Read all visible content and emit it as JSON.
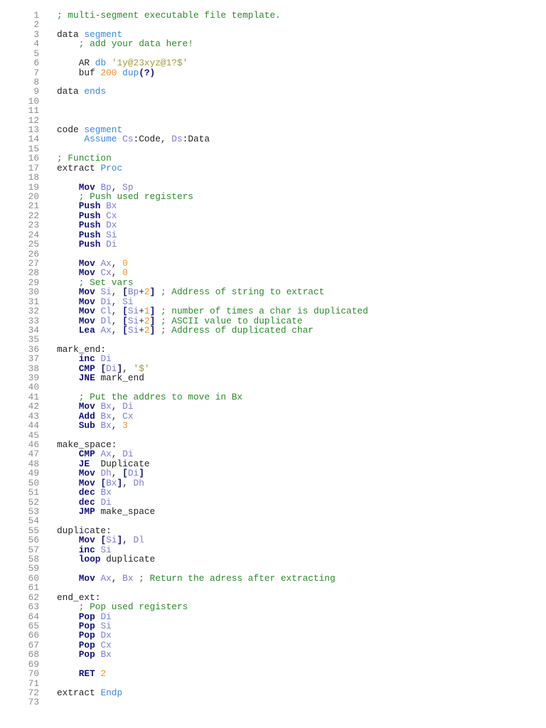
{
  "code": {
    "lines": [
      {
        "t": [
          [
            "; multi-segment executable file template.",
            "c"
          ]
        ]
      },
      {
        "t": []
      },
      {
        "t": [
          [
            "data ",
            "p"
          ],
          [
            "segment",
            "d"
          ]
        ]
      },
      {
        "t": [
          [
            "    ; add your data here!",
            "c"
          ]
        ]
      },
      {
        "t": []
      },
      {
        "t": [
          [
            "    AR ",
            "p"
          ],
          [
            "db ",
            "d"
          ],
          [
            "'1y@23xyz@1?$'",
            "s"
          ]
        ]
      },
      {
        "t": [
          [
            "    buf ",
            "p"
          ],
          [
            "200 ",
            "n"
          ],
          [
            "dup",
            "d"
          ],
          [
            "(?)",
            "o"
          ]
        ]
      },
      {
        "t": []
      },
      {
        "t": [
          [
            "data ",
            "p"
          ],
          [
            "ends",
            "d"
          ]
        ]
      },
      {
        "t": []
      },
      {
        "t": []
      },
      {
        "t": []
      },
      {
        "t": [
          [
            "code ",
            "p"
          ],
          [
            "segment",
            "d"
          ]
        ]
      },
      {
        "t": [
          [
            "     Assume ",
            "d"
          ],
          [
            "Cs",
            "r"
          ],
          [
            ":Code, ",
            "p"
          ],
          [
            "Ds",
            "r"
          ],
          [
            ":Data",
            "p"
          ]
        ]
      },
      {
        "t": []
      },
      {
        "t": [
          [
            "; Function",
            "c"
          ]
        ]
      },
      {
        "t": [
          [
            "extract ",
            "p"
          ],
          [
            "Proc",
            "d"
          ]
        ]
      },
      {
        "t": []
      },
      {
        "t": [
          [
            "    Mov ",
            "k"
          ],
          [
            "Bp",
            "r"
          ],
          [
            ", ",
            "p"
          ],
          [
            "Sp",
            "r"
          ]
        ]
      },
      {
        "t": [
          [
            "    ; Push used registers",
            "c"
          ]
        ]
      },
      {
        "t": [
          [
            "    Push ",
            "k"
          ],
          [
            "Bx",
            "r"
          ]
        ]
      },
      {
        "t": [
          [
            "    Push ",
            "k"
          ],
          [
            "Cx",
            "r"
          ]
        ]
      },
      {
        "t": [
          [
            "    Push ",
            "k"
          ],
          [
            "Dx",
            "r"
          ]
        ]
      },
      {
        "t": [
          [
            "    Push ",
            "k"
          ],
          [
            "Si",
            "r"
          ]
        ]
      },
      {
        "t": [
          [
            "    Push ",
            "k"
          ],
          [
            "Di",
            "r"
          ]
        ]
      },
      {
        "t": []
      },
      {
        "t": [
          [
            "    Mov ",
            "k"
          ],
          [
            "Ax",
            "r"
          ],
          [
            ", ",
            "p"
          ],
          [
            "0",
            "n"
          ]
        ]
      },
      {
        "t": [
          [
            "    Mov ",
            "k"
          ],
          [
            "Cx",
            "r"
          ],
          [
            ", ",
            "p"
          ],
          [
            "0",
            "n"
          ]
        ]
      },
      {
        "t": [
          [
            "    ; Set vars",
            "c"
          ]
        ]
      },
      {
        "t": [
          [
            "    Mov ",
            "k"
          ],
          [
            "Si",
            "r"
          ],
          [
            ", ",
            "p"
          ],
          [
            "[",
            "o"
          ],
          [
            "Bp",
            "r"
          ],
          [
            "+",
            "p"
          ],
          [
            "2",
            "n"
          ],
          [
            "]",
            "o"
          ],
          [
            " ; Address of string to extract",
            "c"
          ]
        ]
      },
      {
        "t": [
          [
            "    Mov ",
            "k"
          ],
          [
            "Di",
            "r"
          ],
          [
            ", ",
            "p"
          ],
          [
            "Si",
            "r"
          ]
        ]
      },
      {
        "t": [
          [
            "    Mov ",
            "k"
          ],
          [
            "Cl",
            "r"
          ],
          [
            ", ",
            "p"
          ],
          [
            "[",
            "o"
          ],
          [
            "Si",
            "r"
          ],
          [
            "+",
            "p"
          ],
          [
            "1",
            "n"
          ],
          [
            "]",
            "o"
          ],
          [
            " ; number of times a char is duplicated",
            "c"
          ]
        ]
      },
      {
        "t": [
          [
            "    Mov ",
            "k"
          ],
          [
            "Dl",
            "r"
          ],
          [
            ", ",
            "p"
          ],
          [
            "[",
            "o"
          ],
          [
            "Si",
            "r"
          ],
          [
            "+",
            "p"
          ],
          [
            "2",
            "n"
          ],
          [
            "]",
            "o"
          ],
          [
            " ; ASCII value to duplicate",
            "c"
          ]
        ]
      },
      {
        "t": [
          [
            "    Lea ",
            "k"
          ],
          [
            "Ax",
            "r"
          ],
          [
            ", ",
            "p"
          ],
          [
            "[",
            "o"
          ],
          [
            "Si",
            "r"
          ],
          [
            "+",
            "p"
          ],
          [
            "2",
            "n"
          ],
          [
            "]",
            "o"
          ],
          [
            " ; Address of duplicated char",
            "c"
          ]
        ]
      },
      {
        "t": []
      },
      {
        "t": [
          [
            "mark_end:",
            "p"
          ]
        ]
      },
      {
        "t": [
          [
            "    inc ",
            "k"
          ],
          [
            "Di",
            "r"
          ]
        ]
      },
      {
        "t": [
          [
            "    CMP ",
            "k"
          ],
          [
            "[",
            "o"
          ],
          [
            "Di",
            "r"
          ],
          [
            "]",
            "o"
          ],
          [
            ", ",
            "p"
          ],
          [
            "'$'",
            "s"
          ]
        ]
      },
      {
        "t": [
          [
            "    JNE ",
            "k"
          ],
          [
            "mark_end",
            "p"
          ]
        ]
      },
      {
        "t": []
      },
      {
        "t": [
          [
            "    ; Put the addres to move in Bx",
            "c"
          ]
        ]
      },
      {
        "t": [
          [
            "    Mov ",
            "k"
          ],
          [
            "Bx",
            "r"
          ],
          [
            ", ",
            "p"
          ],
          [
            "Di",
            "r"
          ]
        ]
      },
      {
        "t": [
          [
            "    Add ",
            "k"
          ],
          [
            "Bx",
            "r"
          ],
          [
            ", ",
            "p"
          ],
          [
            "Cx",
            "r"
          ]
        ]
      },
      {
        "t": [
          [
            "    Sub ",
            "k"
          ],
          [
            "Bx",
            "r"
          ],
          [
            ", ",
            "p"
          ],
          [
            "3",
            "n"
          ]
        ]
      },
      {
        "t": []
      },
      {
        "t": [
          [
            "make_space:",
            "p"
          ]
        ]
      },
      {
        "t": [
          [
            "    CMP ",
            "k"
          ],
          [
            "Ax",
            "r"
          ],
          [
            ", ",
            "p"
          ],
          [
            "Di",
            "r"
          ]
        ]
      },
      {
        "t": [
          [
            "    JE  ",
            "k"
          ],
          [
            "Duplicate",
            "p"
          ]
        ]
      },
      {
        "t": [
          [
            "    Mov ",
            "k"
          ],
          [
            "Dh",
            "r"
          ],
          [
            ", ",
            "p"
          ],
          [
            "[",
            "o"
          ],
          [
            "Di",
            "r"
          ],
          [
            "]",
            "o"
          ]
        ]
      },
      {
        "t": [
          [
            "    Mov ",
            "k"
          ],
          [
            "[",
            "o"
          ],
          [
            "Bx",
            "r"
          ],
          [
            "]",
            "o"
          ],
          [
            ", ",
            "p"
          ],
          [
            "Dh",
            "r"
          ]
        ]
      },
      {
        "t": [
          [
            "    dec ",
            "k"
          ],
          [
            "Bx",
            "r"
          ]
        ]
      },
      {
        "t": [
          [
            "    dec ",
            "k"
          ],
          [
            "Di",
            "r"
          ]
        ]
      },
      {
        "t": [
          [
            "    JMP ",
            "k"
          ],
          [
            "make_space",
            "p"
          ]
        ]
      },
      {
        "t": []
      },
      {
        "t": [
          [
            "duplicate:",
            "p"
          ]
        ]
      },
      {
        "t": [
          [
            "    Mov ",
            "k"
          ],
          [
            "[",
            "o"
          ],
          [
            "Si",
            "r"
          ],
          [
            "]",
            "o"
          ],
          [
            ", ",
            "p"
          ],
          [
            "Dl",
            "r"
          ]
        ]
      },
      {
        "t": [
          [
            "    inc ",
            "k"
          ],
          [
            "Si",
            "r"
          ]
        ]
      },
      {
        "t": [
          [
            "    loop ",
            "k"
          ],
          [
            "duplicate",
            "p"
          ]
        ]
      },
      {
        "t": []
      },
      {
        "t": [
          [
            "    Mov ",
            "k"
          ],
          [
            "Ax",
            "r"
          ],
          [
            ", ",
            "p"
          ],
          [
            "Bx",
            "r"
          ],
          [
            " ; Return the adress after extracting",
            "c"
          ]
        ]
      },
      {
        "t": []
      },
      {
        "t": [
          [
            "end_ext:",
            "p"
          ]
        ]
      },
      {
        "t": [
          [
            "    ; Pop used registers",
            "c"
          ]
        ]
      },
      {
        "t": [
          [
            "    Pop ",
            "k"
          ],
          [
            "Di",
            "r"
          ]
        ]
      },
      {
        "t": [
          [
            "    Pop ",
            "k"
          ],
          [
            "Si",
            "r"
          ]
        ]
      },
      {
        "t": [
          [
            "    Pop ",
            "k"
          ],
          [
            "Dx",
            "r"
          ]
        ]
      },
      {
        "t": [
          [
            "    Pop ",
            "k"
          ],
          [
            "Cx",
            "r"
          ]
        ]
      },
      {
        "t": [
          [
            "    Pop ",
            "k"
          ],
          [
            "Bx",
            "r"
          ]
        ]
      },
      {
        "t": []
      },
      {
        "t": [
          [
            "    RET ",
            "k"
          ],
          [
            "2",
            "n"
          ]
        ]
      },
      {
        "t": []
      },
      {
        "t": [
          [
            "extract ",
            "p"
          ],
          [
            "Endp",
            "d"
          ]
        ]
      },
      {
        "t": []
      }
    ]
  }
}
